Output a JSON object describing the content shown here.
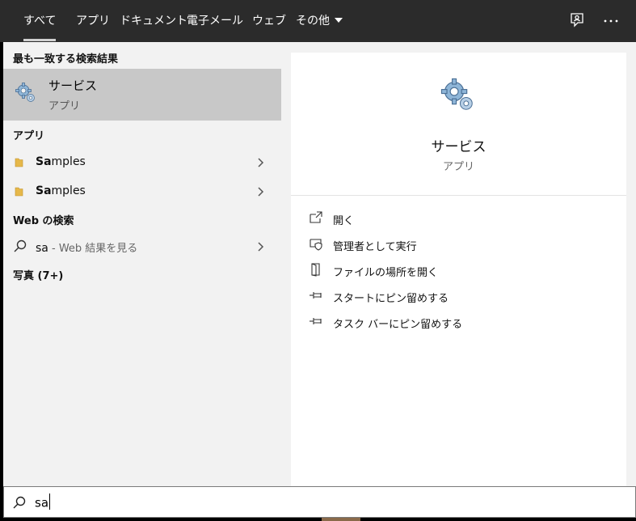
{
  "tabs": [
    {
      "label": "すべて",
      "active": true
    },
    {
      "label": "アプリ"
    },
    {
      "label": "ドキュメント"
    },
    {
      "label": "電子メール"
    },
    {
      "label": "ウェブ"
    },
    {
      "label": "その他"
    }
  ],
  "top_icons": [
    "feedback-icon",
    "more-icon"
  ],
  "left": {
    "best_match_header": "最も一致する検索結果",
    "best_match": {
      "title": "サービス",
      "subtitle": "アプリ",
      "icon": "gear-icon"
    },
    "apps_header": "アプリ",
    "apps": [
      {
        "highlight": "Sa",
        "rest": "mples",
        "icon": "folder-icon"
      },
      {
        "highlight": "Sa",
        "rest": "mples",
        "icon": "folder-icon"
      }
    ],
    "web_header": "Web の検索",
    "web_result": {
      "query": "sa",
      "suffix": " - Web 結果を見る",
      "icon": "search-icon"
    },
    "photos_header": "写真 (7+)"
  },
  "right": {
    "title": "サービス",
    "subtitle": "アプリ",
    "actions": [
      {
        "label": "開く",
        "icon": "open-icon"
      },
      {
        "label": "管理者として実行",
        "icon": "run-as-admin-icon"
      },
      {
        "label": "ファイルの場所を開く",
        "icon": "file-location-icon"
      },
      {
        "label": "スタートにピン留めする",
        "icon": "pin-start-icon"
      },
      {
        "label": "タスク バーにピン留めする",
        "icon": "pin-taskbar-icon"
      }
    ]
  },
  "search": {
    "value": "sa",
    "icon": "search-icon"
  },
  "colors": {
    "tabbar": "#2b2b2b",
    "selected": "#c8c8c8",
    "panel": "#f2f2f2"
  }
}
